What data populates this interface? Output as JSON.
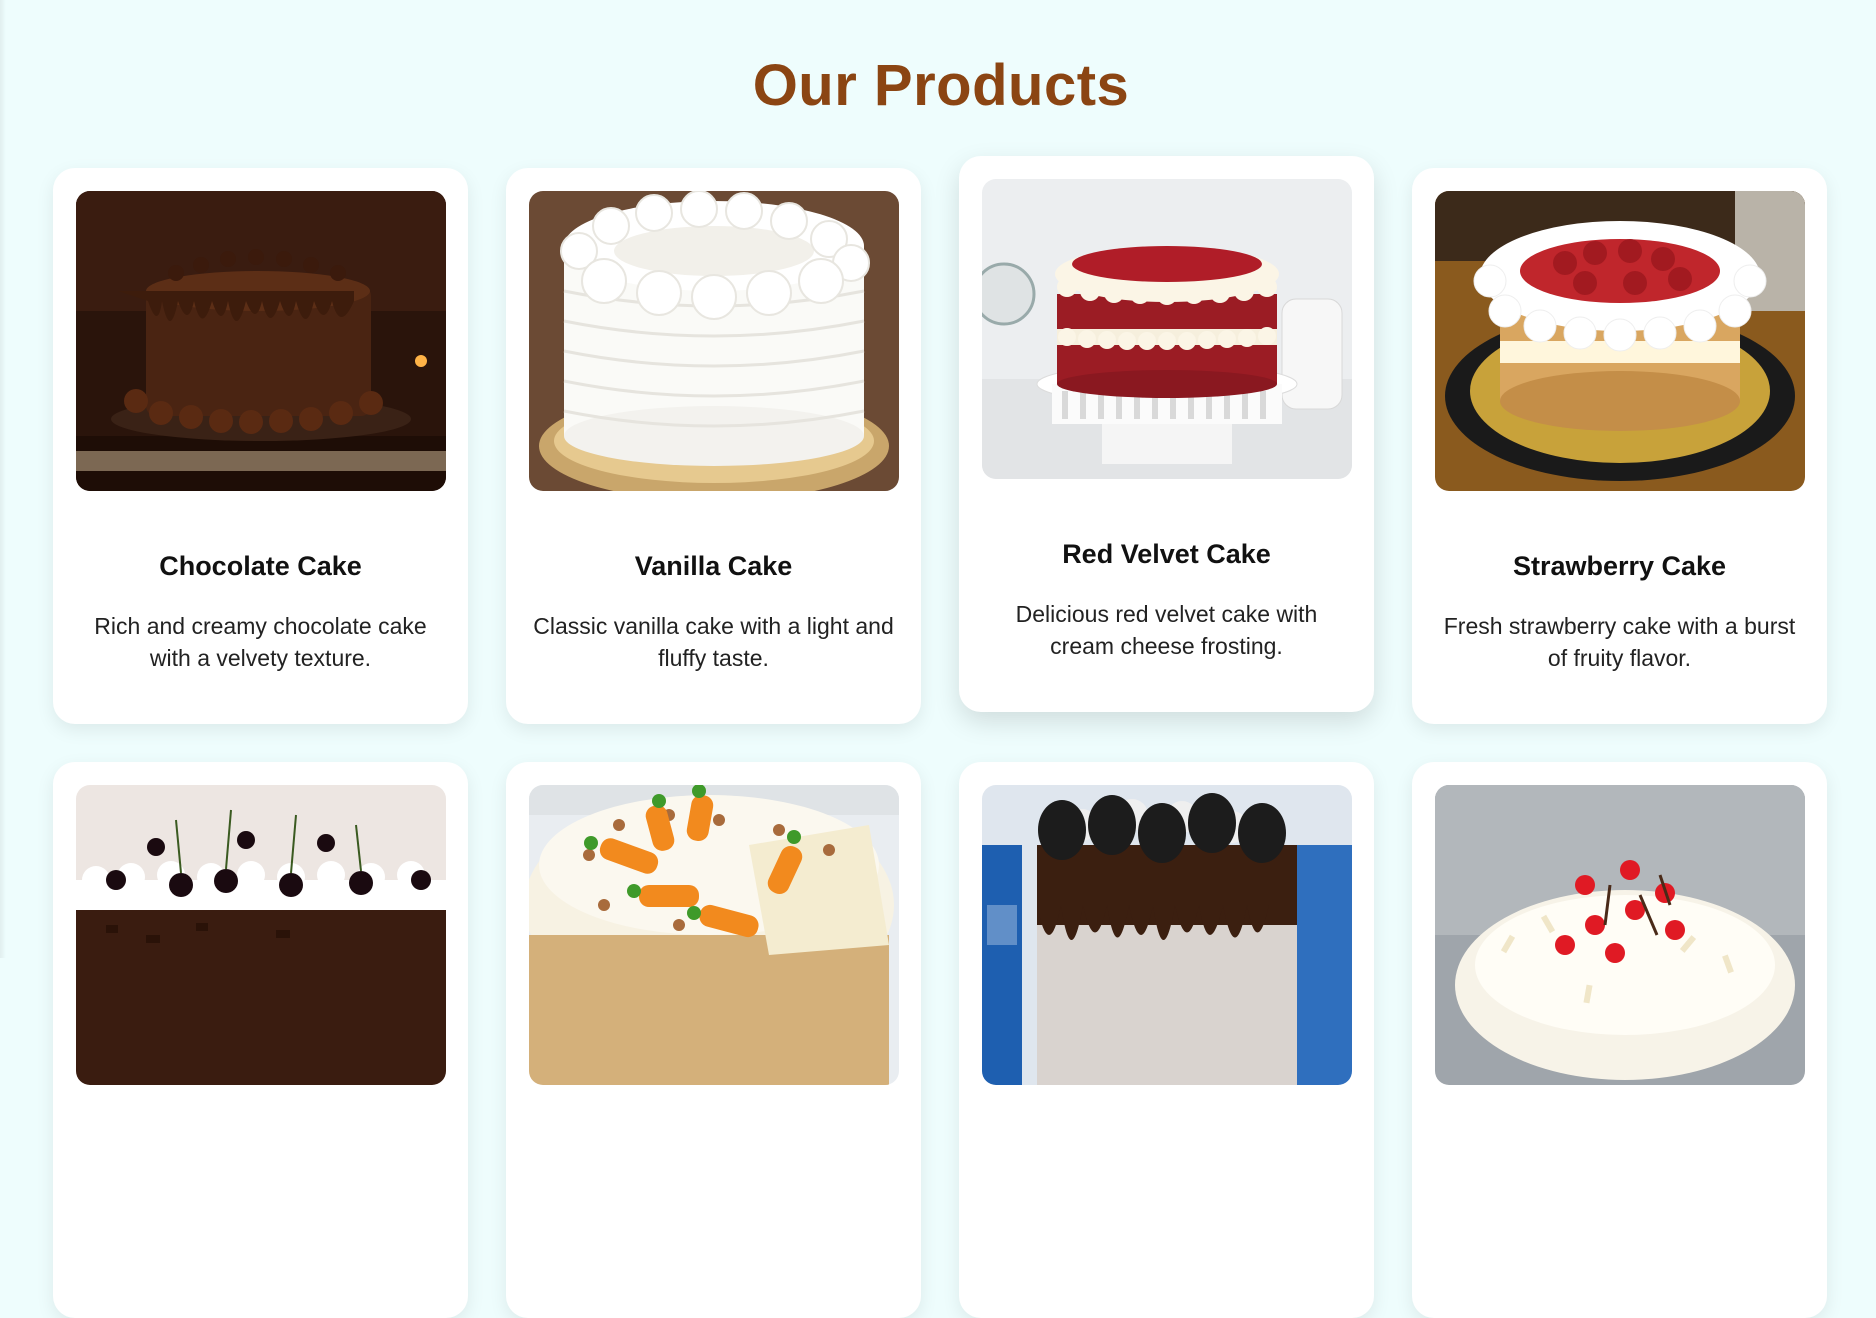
{
  "section": {
    "title": "Our Products"
  },
  "products": [
    {
      "name": "Chocolate Cake",
      "description": "Rich and creamy chocolate cake with a velvety texture."
    },
    {
      "name": "Vanilla Cake",
      "description": "Classic vanilla cake with a light and fluffy taste."
    },
    {
      "name": "Red Velvet Cake",
      "description": "Delicious red velvet cake with cream cheese frosting."
    },
    {
      "name": "Strawberry Cake",
      "description": "Fresh strawberry cake with a burst of fruity flavor."
    },
    {
      "name": "",
      "description": ""
    },
    {
      "name": "",
      "description": ""
    },
    {
      "name": "",
      "description": ""
    },
    {
      "name": "",
      "description": ""
    }
  ],
  "colors": {
    "background": "#eefdfd",
    "title": "#8b4513",
    "card": "#ffffff"
  }
}
